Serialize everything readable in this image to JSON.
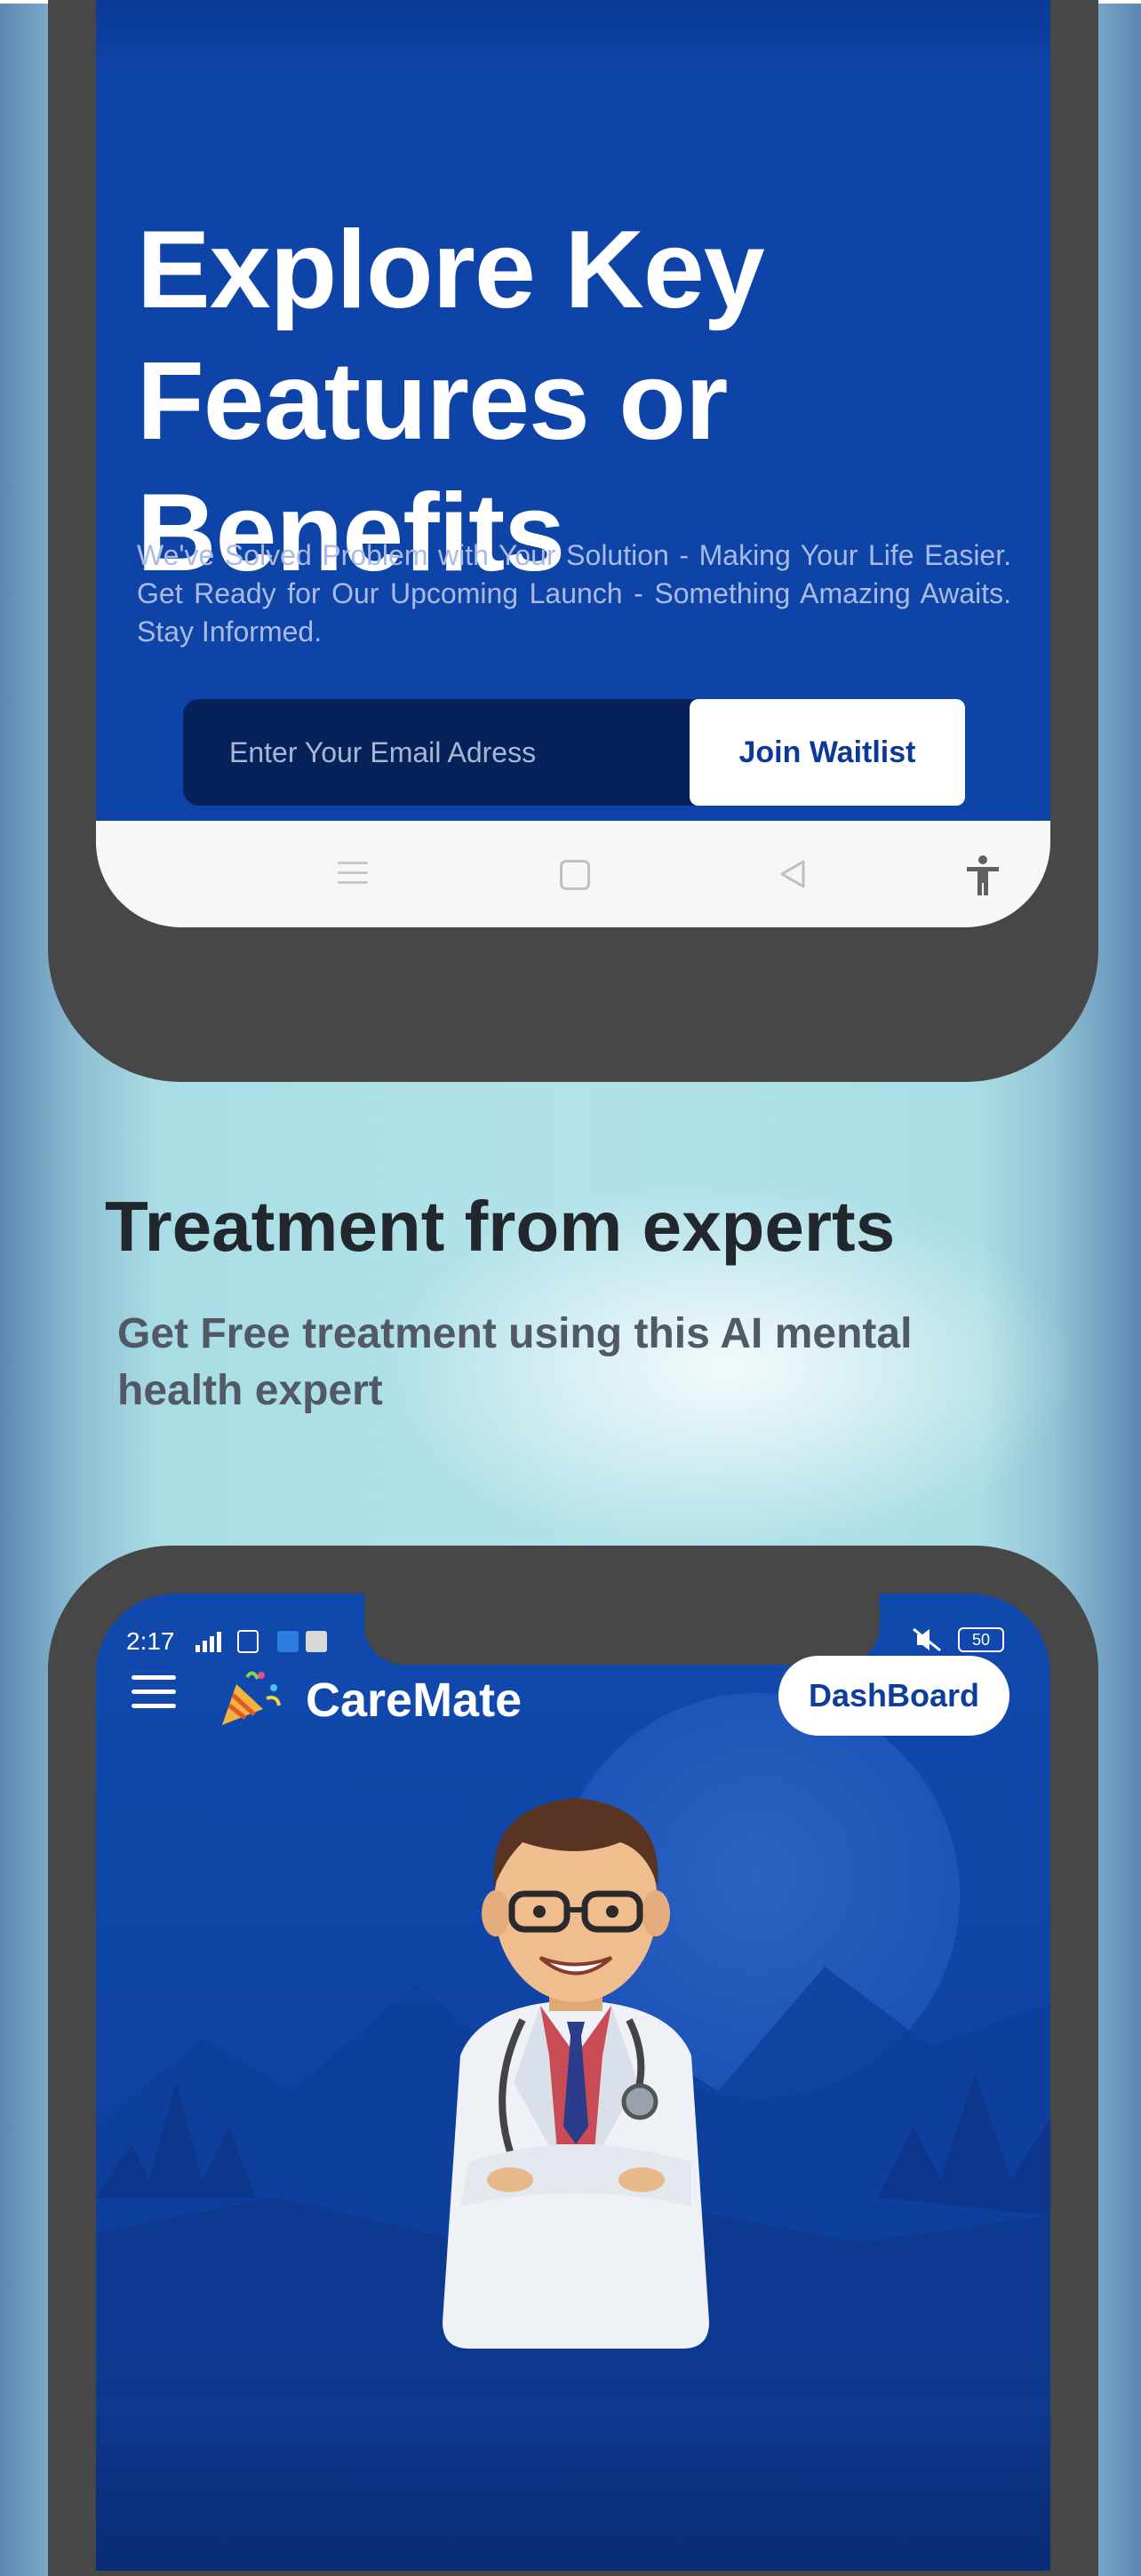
{
  "hero": {
    "title": "Explore Key Features or Benefits",
    "description": "We've Solved Problem with Your Solution - Making Your Life Easier. Get Ready for Our Upcoming Launch - Something Amazing Awaits. Stay Informed.",
    "email_placeholder": "Enter Your Email Adress",
    "join_label": "Join Waitlist"
  },
  "section": {
    "title": "Treatment from experts",
    "subtitle": "Get Free treatment using this AI mental health expert"
  },
  "app": {
    "status_time": "2:17",
    "battery": "50",
    "brand": "CareMate",
    "dashboard_label": "DashBoard"
  },
  "icons": {
    "nav_recents": "recents-icon",
    "nav_home": "home-icon",
    "nav_back": "back-icon",
    "accessibility": "accessibility-icon",
    "menu": "hamburger-menu-icon",
    "party": "party-popper-icon"
  },
  "colors": {
    "primary_blue": "#0e43a8",
    "dark_input": "#07215a",
    "frame": "#474747",
    "background": "#b3e2e9"
  }
}
